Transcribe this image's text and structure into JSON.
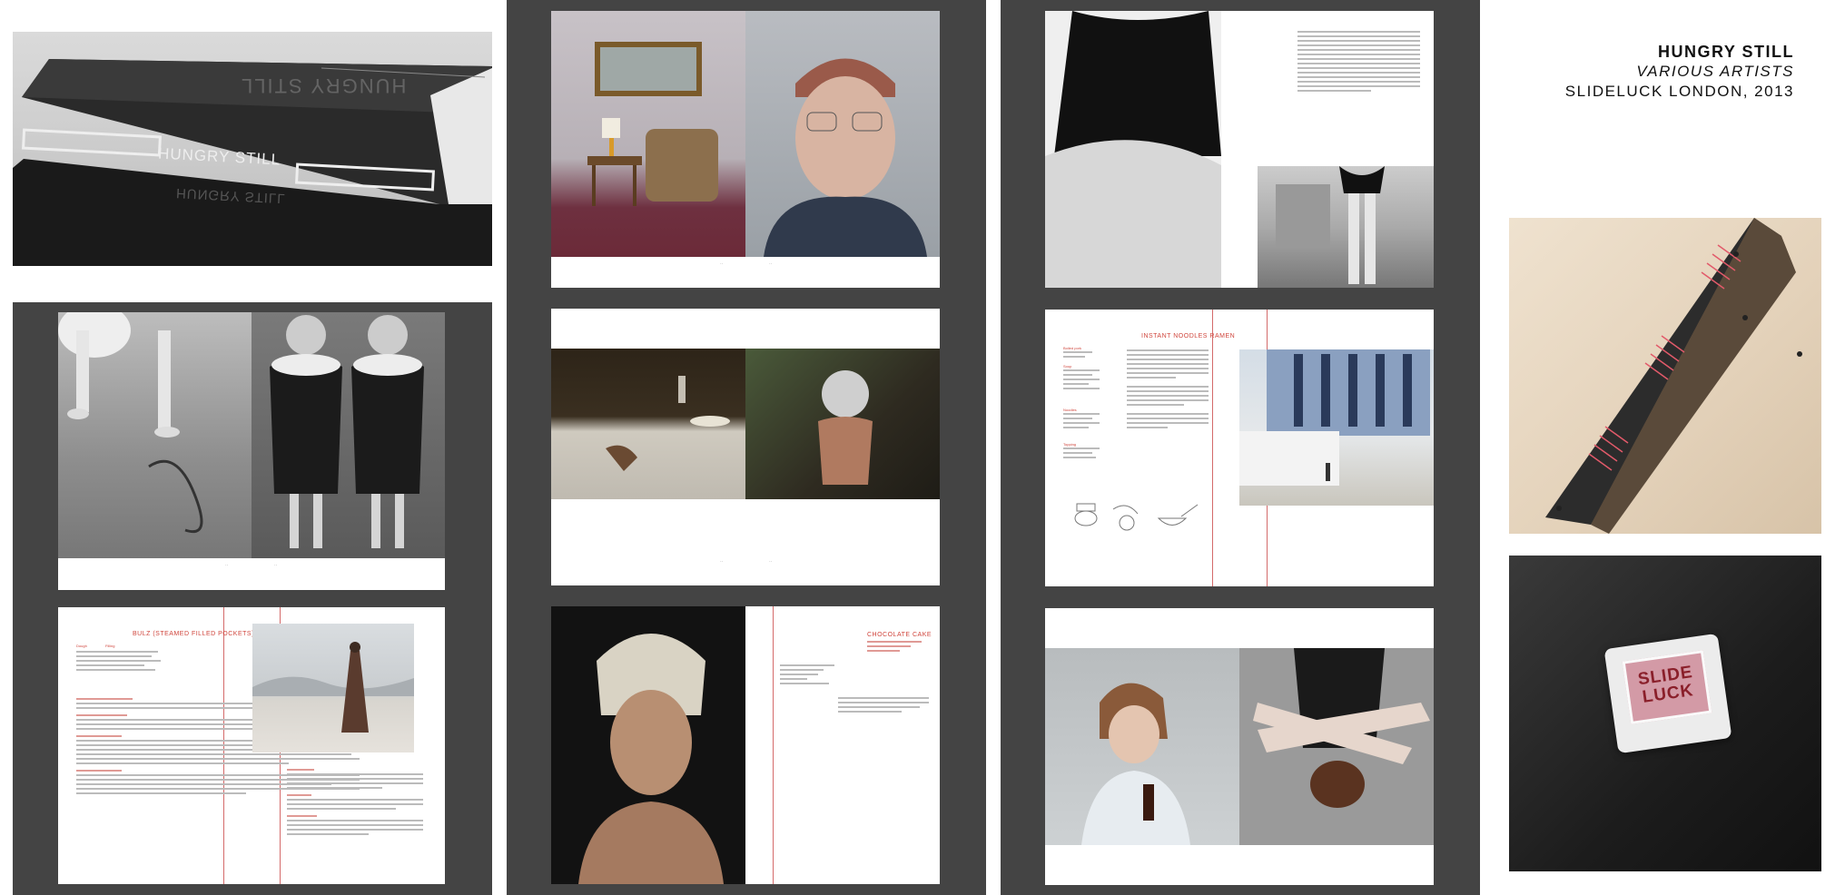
{
  "title_block": {
    "title": "HUNGRY STILL",
    "subtitle": "VARIOUS ARTISTS",
    "event": "SLIDELUCK LONDON, 2013"
  },
  "book_cover": {
    "spine_text": "HUNGRY STILL",
    "reflection_text": "HUNGRY STILL"
  },
  "recipes": {
    "bulz": {
      "title": "BULZ (STEAMED FILLED POCKETS)",
      "col1": "Dough",
      "col2": "Filling"
    },
    "chocolate": {
      "title": "CHOCOLATE CAKE"
    },
    "ramen": {
      "title": "INSTANT NOODLES RAMEN",
      "s1": "Boiled pork",
      "s2": "Soup",
      "s3": "Noodles",
      "s4": "Topping"
    }
  },
  "sticker": {
    "line1": "SLIDE",
    "line2": "LUCK"
  },
  "colors": {
    "panel": "#444444",
    "accent_red": "#d0453c"
  }
}
